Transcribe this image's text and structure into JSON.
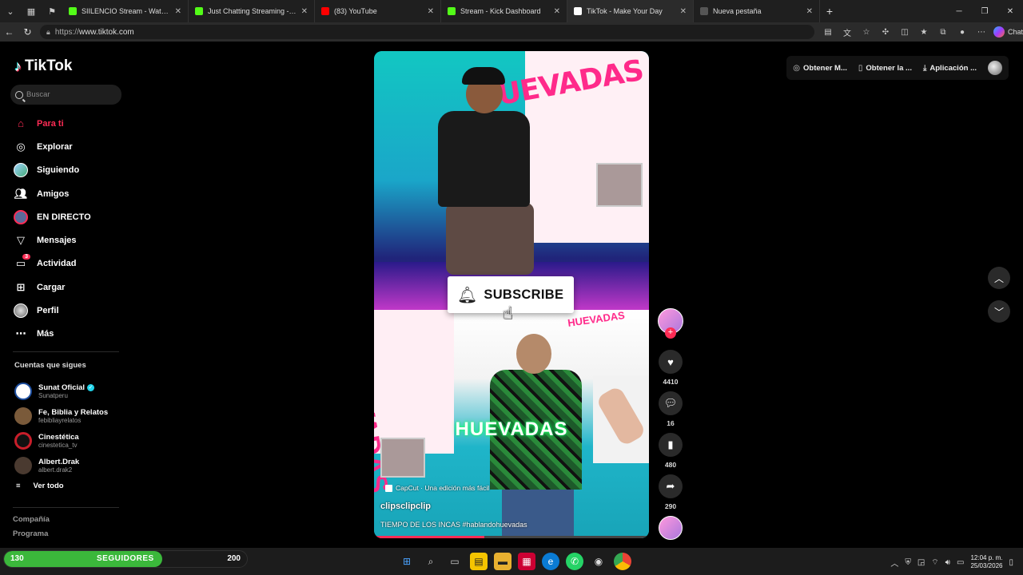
{
  "browser": {
    "tabs": [
      {
        "title": "SIILENCIO Stream - Watch Live on",
        "favicon_color": "#53fc18",
        "active": false
      },
      {
        "title": "Just Chatting Streaming - Live Stre",
        "favicon_color": "#53fc18",
        "active": false
      },
      {
        "title": "(83) YouTube",
        "favicon_color": "#ff0000",
        "active": false
      },
      {
        "title": "Stream - Kick Dashboard",
        "favicon_color": "#53fc18",
        "active": false
      },
      {
        "title": "TikTok - Make Your Day",
        "favicon_color": "#ffffff",
        "active": true
      },
      {
        "title": "Nueva pestaña",
        "favicon_color": "#555555",
        "active": false
      }
    ],
    "url_prefix": "https://",
    "url_domain": "www.tiktok.com",
    "copilot_label": "Chat"
  },
  "sidebar": {
    "logo_text": "TikTok",
    "search_placeholder": "Buscar",
    "nav": [
      {
        "label": "Para ti",
        "icon": "home-icon",
        "active": true
      },
      {
        "label": "Explorar",
        "icon": "compass-icon"
      },
      {
        "label": "Siguiendo",
        "icon": "avatar-icon"
      },
      {
        "label": "Amigos",
        "icon": "friends-icon"
      },
      {
        "label": "EN DIRECTO",
        "icon": "live-icon"
      },
      {
        "label": "Mensajes",
        "icon": "send-icon"
      },
      {
        "label": "Actividad",
        "icon": "inbox-icon",
        "badge": "3"
      },
      {
        "label": "Cargar",
        "icon": "upload-icon"
      },
      {
        "label": "Perfil",
        "icon": "profile-icon"
      },
      {
        "label": "Más",
        "icon": "more-icon"
      }
    ],
    "following_title": "Cuentas que sigues",
    "following": [
      {
        "name": "Sunat Oficial",
        "handle": "Sunatperu",
        "verified": true,
        "avatar_color": "#1e4fa0"
      },
      {
        "name": "Fe, Biblia y Relatos",
        "handle": "febibliayrelatos",
        "verified": false,
        "avatar_color": "#7a5a3a"
      },
      {
        "name": "Cinestética",
        "handle": "cinestetica_tv",
        "verified": false,
        "avatar_color": "#c81e2a"
      },
      {
        "name": "Albert.Drak",
        "handle": "albert.drak2",
        "verified": false,
        "avatar_color": "#4a3a30"
      }
    ],
    "see_all": "Ver todo",
    "footer_links": [
      "Compañía",
      "Programa"
    ]
  },
  "top_actions": {
    "coins": "Obtener M...",
    "app": "Obtener la ...",
    "desktop": "Aplicación ..."
  },
  "video": {
    "overlay_huevadas": "HUEVADAS",
    "subscribe_label": "SUBSCRIBE",
    "capcut_label": "CapCut · Una edición más fácil",
    "author": "clipsclipclip",
    "description": "TIEMPO DE LOS INCAS #hablandohuevadas",
    "logo_top": "HUEVADAS",
    "logo_mini": "HUEVADAS",
    "progress": 0.4
  },
  "actions": {
    "likes": "4410",
    "comments": "16",
    "saves": "480",
    "shares": "290"
  },
  "overlay_followers": {
    "current": "130",
    "label": "SEGUIDORES",
    "goal": "200",
    "progress": 0.65
  },
  "taskbar": {
    "time": "12:04 p. m.",
    "date": "25/03/2026"
  },
  "colors": {
    "tiktok_red": "#fe2c55",
    "tiktok_cyan": "#25f4ee",
    "follow_bar": "#3bb83b"
  }
}
